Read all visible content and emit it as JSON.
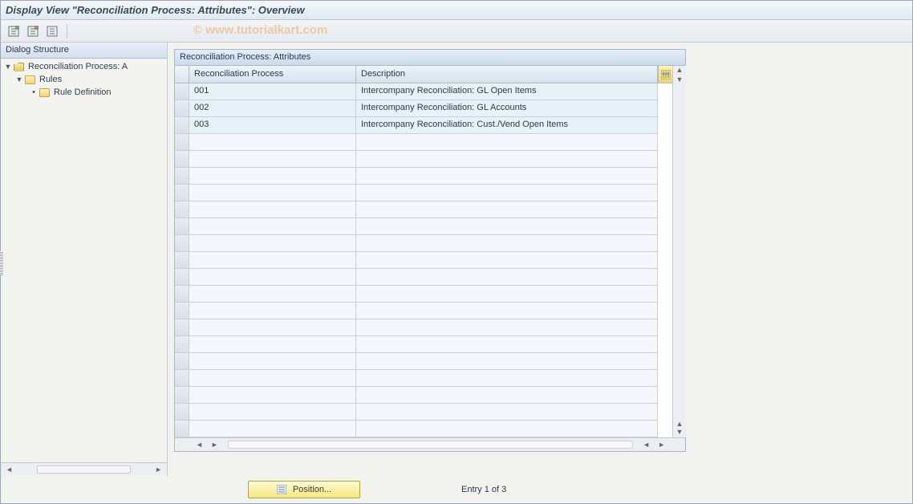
{
  "header": {
    "title": "Display View \"Reconciliation Process: Attributes\": Overview"
  },
  "toolbar": {
    "watermark": "© www.tutorialkart.com"
  },
  "sidebar": {
    "title": "Dialog Structure",
    "nodes": {
      "root": {
        "label": "Reconciliation Process: A"
      },
      "rules": {
        "label": "Rules"
      },
      "ruledef": {
        "label": "Rule Definition"
      }
    }
  },
  "grid": {
    "title": "Reconciliation Process: Attributes",
    "columns": {
      "proc": "Reconciliation Process",
      "desc": "Description"
    },
    "rows": [
      {
        "proc": "001",
        "desc": "Intercompany Reconciliation: GL Open Items"
      },
      {
        "proc": "002",
        "desc": "Intercompany Reconciliation: GL Accounts"
      },
      {
        "proc": "003",
        "desc": "Intercompany Reconciliation: Cust./Vend Open Items"
      }
    ]
  },
  "footer": {
    "position_label": "Position...",
    "status": "Entry 1 of 3"
  }
}
